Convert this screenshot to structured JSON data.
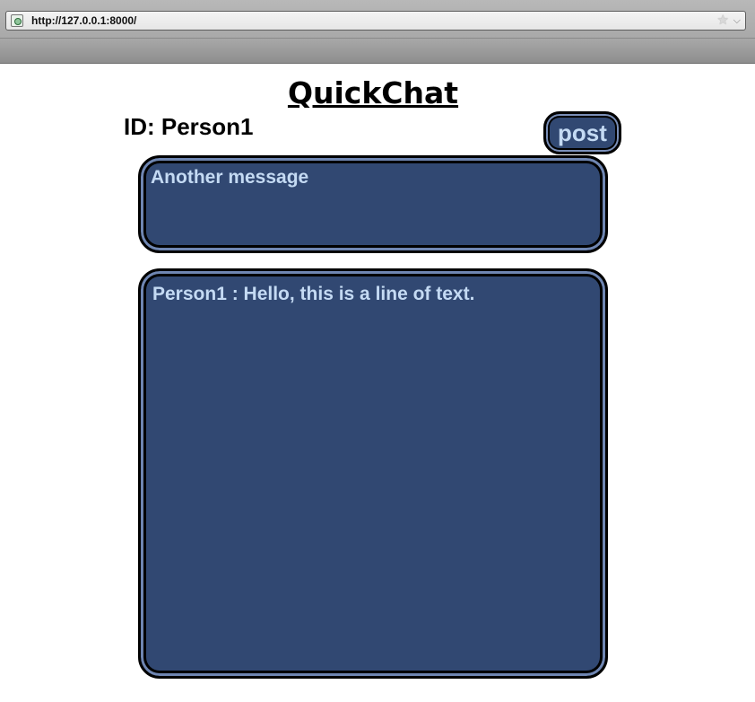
{
  "browser": {
    "url": "http://127.0.0.1:8000/",
    "star_icon": "bookmark-star-icon",
    "menu_icon": "chevron-down-icon"
  },
  "page": {
    "title": "QuickChat",
    "user_id_label": "ID: Person1",
    "post_label": "post",
    "message_value": "Another message",
    "messages": [
      "Person1 : Hello, this is a line of text."
    ]
  },
  "colors": {
    "panel_fill": "#314872",
    "panel_text": "#c4daf3",
    "border": "#000000"
  }
}
